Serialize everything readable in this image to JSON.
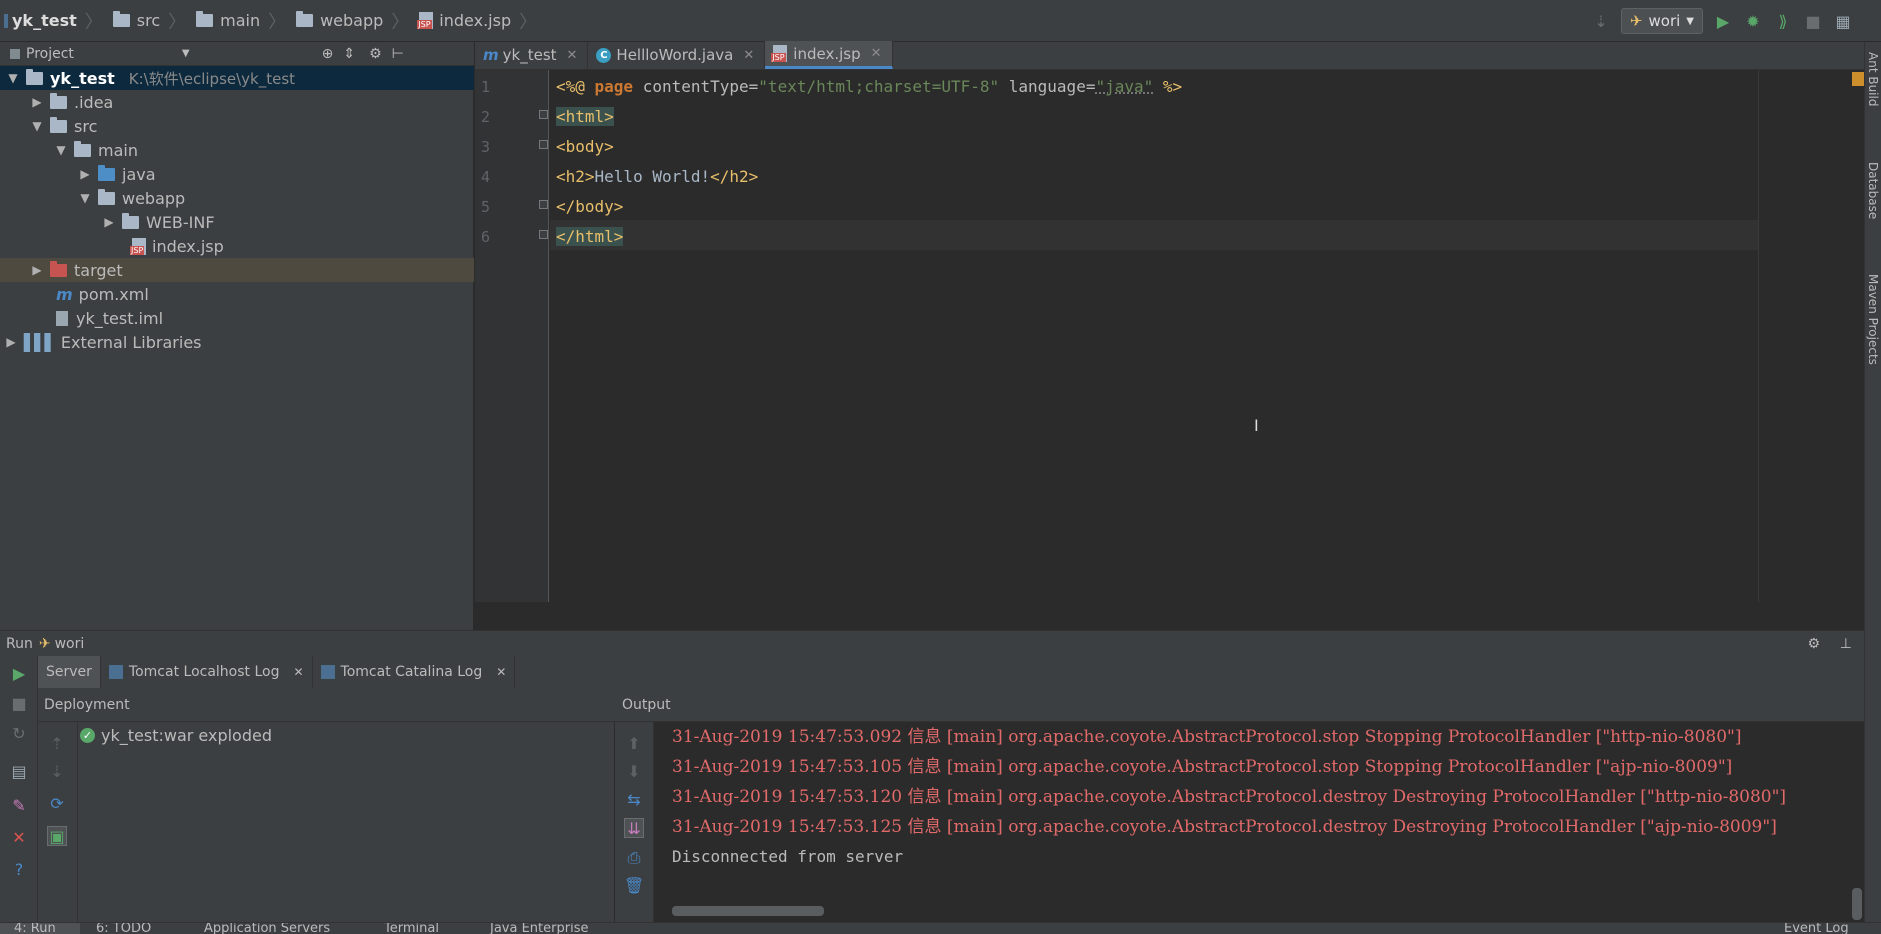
{
  "breadcrumb": [
    "yk_test",
    "src",
    "main",
    "webapp",
    "index.jsp"
  ],
  "toolbar": {
    "run_config": "wori"
  },
  "project": {
    "header": "Project",
    "tree": [
      {
        "label": "yk_test",
        "path": "K:\\软件\\eclipse\\yk_test",
        "icon": "module-folder-icon",
        "expanded": true
      },
      {
        "label": ".idea",
        "icon": "folder-icon"
      },
      {
        "label": "src",
        "icon": "folder-icon"
      },
      {
        "label": "main",
        "icon": "folder-icon"
      },
      {
        "label": "java",
        "icon": "source-folder-icon"
      },
      {
        "label": "webapp",
        "icon": "folder-icon"
      },
      {
        "label": "WEB-INF",
        "icon": "folder-icon"
      },
      {
        "label": "index.jsp",
        "icon": "jsp-file-icon"
      },
      {
        "label": "target",
        "icon": "excluded-folder-icon"
      },
      {
        "label": "pom.xml",
        "icon": "maven-icon"
      },
      {
        "label": "yk_test.iml",
        "icon": "iml-file-icon"
      },
      {
        "label": "External Libraries",
        "icon": "libraries-icon"
      }
    ]
  },
  "editor": {
    "tabs": [
      {
        "label": "yk_test"
      },
      {
        "label": "HellloWord.java"
      },
      {
        "label": "index.jsp"
      }
    ],
    "line_numbers": [
      "1",
      "2",
      "3",
      "4",
      "5",
      "6"
    ],
    "code": {
      "l1_open": "<%@ ",
      "l1_page": "page",
      "l1_attr1": " contentType=",
      "l1_val1": "\"text/html;charset=UTF-8\"",
      "l1_attr2": " language=",
      "l1_val2": "\"java\"",
      "l1_close": " %>",
      "l2": "<html>",
      "l3": "<body>",
      "l4_open": "<h2>",
      "l4_text": "Hello World!",
      "l4_close": "</h2>",
      "l5": "</body>",
      "l6": "</html>"
    }
  },
  "right_strip": [
    "Ant Build",
    "Database",
    "Maven Projects"
  ],
  "run": {
    "header_prefix": "Run",
    "config": "wori",
    "tabs": [
      "Server",
      "Tomcat Localhost Log",
      "Tomcat Catalina Log"
    ],
    "deployment_header": "Deployment",
    "output_header": "Output",
    "deployment_item": "yk_test:war exploded",
    "log_lines": [
      "31-Aug-2019 15:47:53.092 信息 [main] org.apache.coyote.AbstractProtocol.stop Stopping ProtocolHandler [\"http-nio-8080\"]",
      "31-Aug-2019 15:47:53.105 信息 [main] org.apache.coyote.AbstractProtocol.stop Stopping ProtocolHandler [\"ajp-nio-8009\"]",
      "31-Aug-2019 15:47:53.120 信息 [main] org.apache.coyote.AbstractProtocol.destroy Destroying ProtocolHandler [\"http-nio-8080\"]",
      "31-Aug-2019 15:47:53.125 信息 [main] org.apache.coyote.AbstractProtocol.destroy Destroying ProtocolHandler [\"ajp-nio-8009\"]"
    ],
    "status_line": "Disconnected from server"
  },
  "bottom_tabs": [
    "4: Run",
    "6: TODO",
    "Application Servers",
    "Terminal",
    "Java Enterprise",
    "Event Log"
  ],
  "colors": {
    "accent": "#4a88c7",
    "error_log": "#e36a6a",
    "tag": "#e8bf6a",
    "string": "#6a8759"
  }
}
